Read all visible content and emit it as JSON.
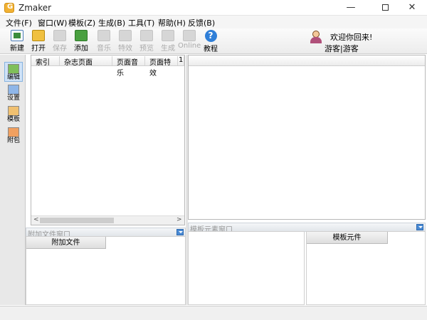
{
  "window": {
    "title": "Zmaker",
    "minimize": "—",
    "close": "✕"
  },
  "menu": [
    "文件(F)",
    "窗口(W)",
    "模板(Z)",
    "生成(B)",
    "工具(T)",
    "帮助(H)",
    "反馈(B)"
  ],
  "toolbar": {
    "new": "新建",
    "open": "打开",
    "save": "保存",
    "add": "添加",
    "music": "音乐",
    "effects": "特效",
    "preview": "预览",
    "generate": "生成",
    "online": "Online",
    "tutorial": "教程"
  },
  "user": {
    "welcome": "欢迎你回来!",
    "name": "游客|游客"
  },
  "sidebar": [
    "编辑",
    "设置",
    "模板",
    "附包"
  ],
  "pages_table": {
    "columns": [
      "索引",
      "杂志页面",
      "页面音乐",
      "页面特效",
      "1"
    ]
  },
  "attach_panel": {
    "title": "附加文件窗口",
    "column": "附加文件"
  },
  "template_panel": {
    "title": "模板元素窗口",
    "column": "模板元件"
  }
}
